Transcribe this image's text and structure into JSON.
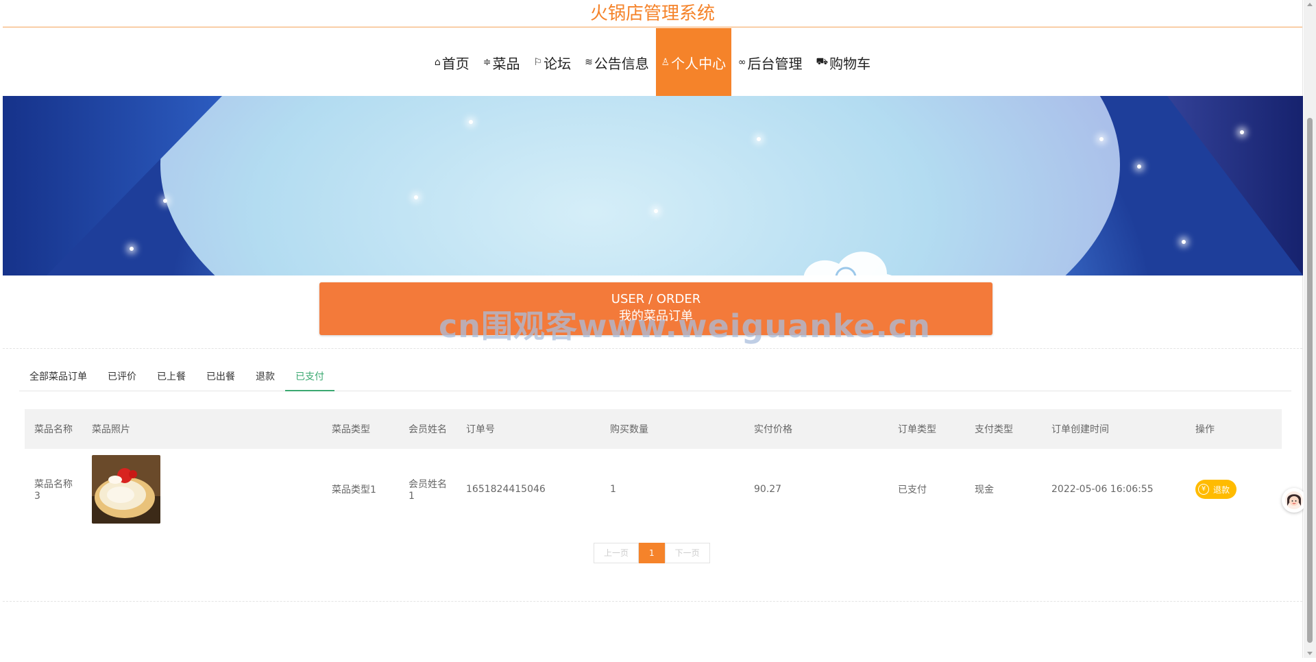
{
  "site": {
    "title": "火锅店管理系统"
  },
  "nav": {
    "items": [
      {
        "icon": "home-icon",
        "glyph": "⌂",
        "label": "首页"
      },
      {
        "icon": "list-icon",
        "glyph": "≑",
        "label": "菜品"
      },
      {
        "icon": "flag-icon",
        "glyph": "⚐",
        "label": "论坛"
      },
      {
        "icon": "layers-icon",
        "glyph": "≋",
        "label": "公告信息"
      },
      {
        "icon": "user-icon",
        "glyph": "♙",
        "label": "个人中心",
        "active": true
      },
      {
        "icon": "link-icon",
        "glyph": "∞",
        "label": "后台管理"
      },
      {
        "icon": "cart-icon",
        "glyph": "⛟",
        "label": "购物车"
      }
    ]
  },
  "banner": {
    "slides": 3,
    "active_slide": 1
  },
  "order_header": {
    "en": "USER / ORDER",
    "cn": "我的菜品订单"
  },
  "watermark": "cn围观客www.weiguanke.cn",
  "tabs": [
    {
      "label": "全部菜品订单"
    },
    {
      "label": "已评价"
    },
    {
      "label": "已上餐"
    },
    {
      "label": "已出餐"
    },
    {
      "label": "退款"
    },
    {
      "label": "已支付",
      "active": true
    }
  ],
  "table": {
    "headers": [
      "菜品名称",
      "菜品照片",
      "菜品类型",
      "会员姓名",
      "订单号",
      "购买数量",
      "实付价格",
      "订单类型",
      "支付类型",
      "订单创建时间",
      "操作"
    ],
    "rows": [
      {
        "name": "菜品名称3",
        "type": "菜品类型1",
        "member": "会员姓名1",
        "order_no": "1651824415046",
        "qty": "1",
        "price": "90.27",
        "order_type": "已支付",
        "pay_type": "现金",
        "created": "2022-05-06 16:06:55",
        "action": "退款"
      }
    ]
  },
  "pager": {
    "prev": "上一页",
    "current": "1",
    "next": "下一页"
  },
  "colors": {
    "accent": "#f5832a",
    "header_bar": "#f37a3a",
    "active_tab": "#3aa870",
    "refund_button": "#ffbb00"
  }
}
